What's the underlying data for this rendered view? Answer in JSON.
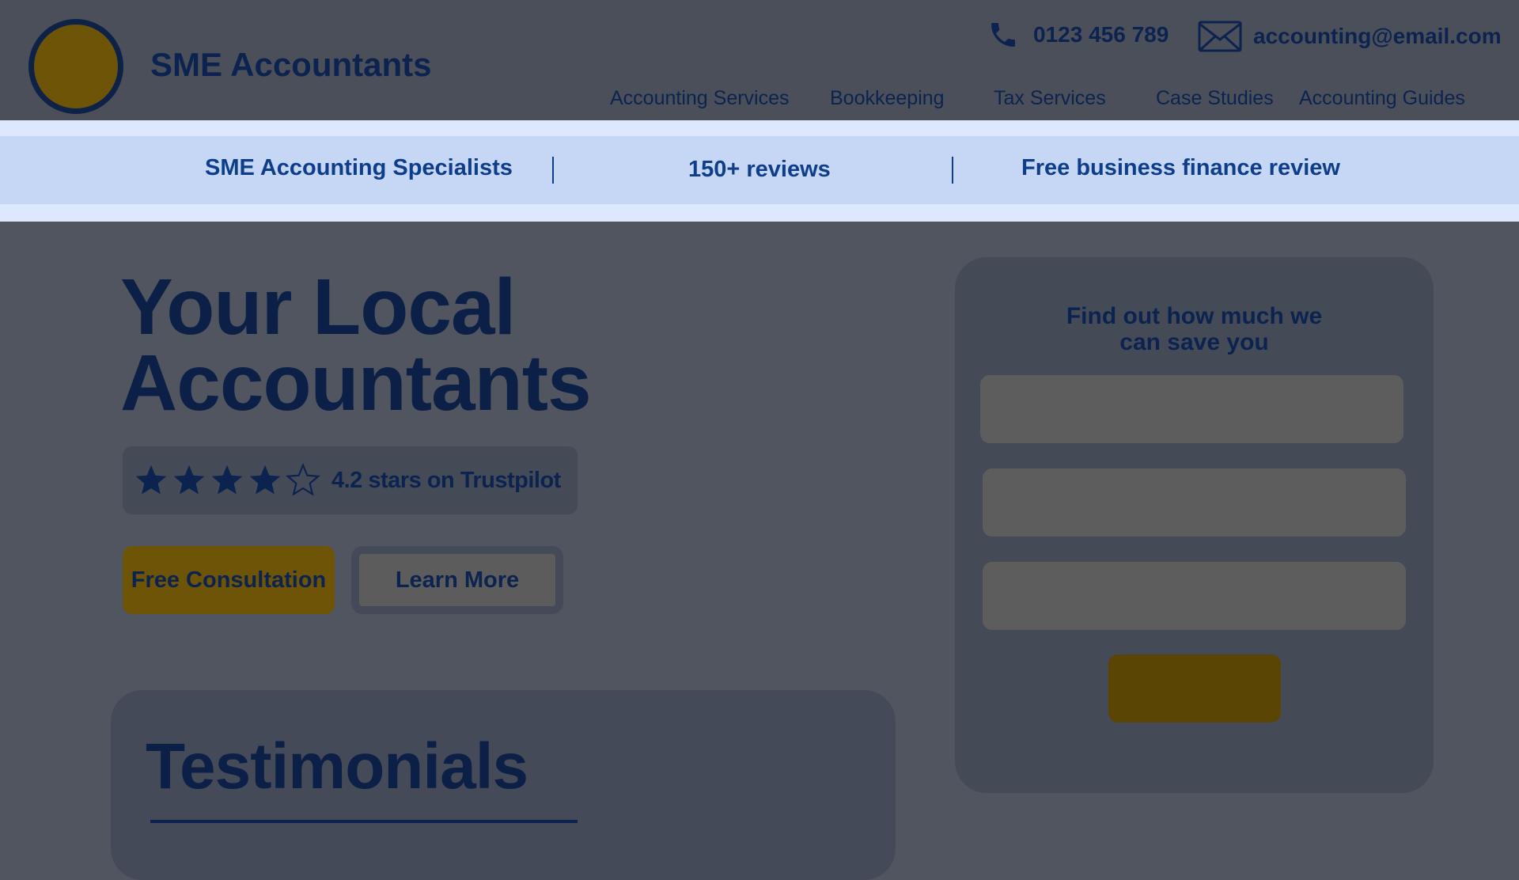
{
  "brand": {
    "name": "SME Accountants"
  },
  "contact": {
    "phone": "0123 456 789",
    "email": "accounting@email.com"
  },
  "nav": [
    "Accounting Services",
    "Bookkeeping",
    "Tax Services",
    "Case Studies",
    "Accounting Guides"
  ],
  "banner": [
    "SME Accounting Specialists",
    "150+ reviews",
    "Free business finance review"
  ],
  "hero": {
    "title_line1": "Your Local",
    "title_line2": "Accountants",
    "rating_value": 4.2,
    "rating_max": 5,
    "rating_text": "4.2 stars on Trustpilot",
    "primary_button": "Free Consultation",
    "secondary_button": "Learn More"
  },
  "testimonials": {
    "title": "Testimonials"
  },
  "form": {
    "title_line1": "Find out how much we",
    "title_line2": "can save you",
    "fields": [
      "",
      "",
      ""
    ],
    "submit_label": ""
  },
  "colors": {
    "page_bg": "#515560",
    "header_bg": "#4a4f5a",
    "navy": "#0c2350",
    "gold": "#6e5406",
    "banner_bg": "#c6d6f5",
    "banner_text": "#0e3d8a"
  },
  "icons": {
    "phone": "phone-icon",
    "email": "envelope-icon",
    "star": "star-icon"
  }
}
